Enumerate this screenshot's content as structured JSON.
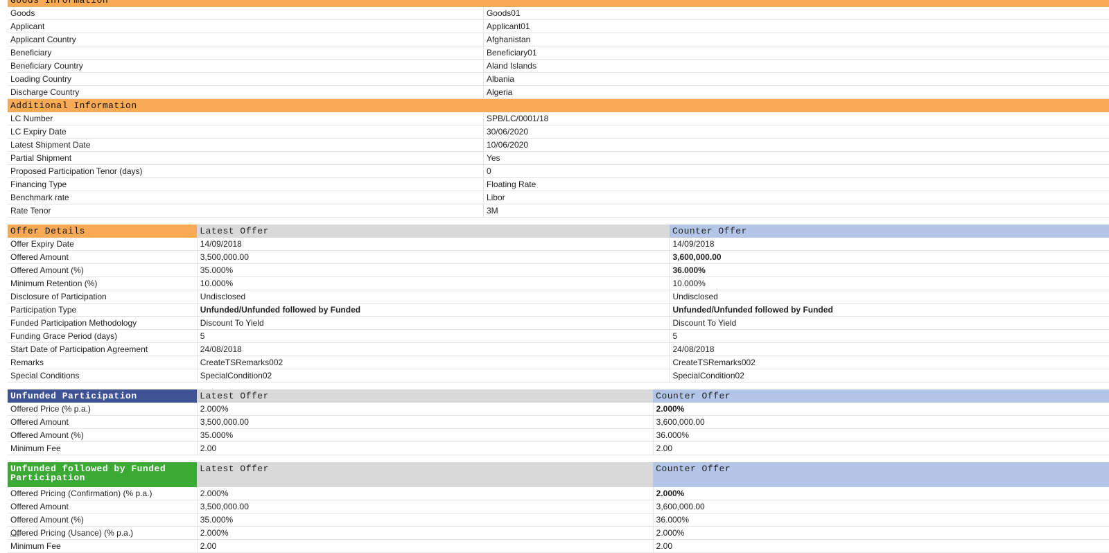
{
  "goods_section": {
    "title": "Goods Information",
    "rows": [
      {
        "label": "Goods",
        "value": "Goods01"
      },
      {
        "label": "Applicant",
        "value": "Applicant01"
      },
      {
        "label": "Applicant Country",
        "value": "Afghanistan"
      },
      {
        "label": "Beneficiary",
        "value": "Beneficiary01"
      },
      {
        "label": "Beneficiary Country",
        "value": "Aland Islands"
      },
      {
        "label": "Loading Country",
        "value": "Albania"
      },
      {
        "label": "Discharge Country",
        "value": "Algeria"
      }
    ]
  },
  "additional_section": {
    "title": "Additional Information",
    "rows": [
      {
        "label": "LC Number",
        "value": "SPB/LC/0001/18"
      },
      {
        "label": "LC Expiry Date",
        "value": "30/06/2020"
      },
      {
        "label": "Latest Shipment Date",
        "value": "10/06/2020"
      },
      {
        "label": "Partial Shipment",
        "value": "Yes"
      },
      {
        "label": "Proposed Participation Tenor (days)",
        "value": "0"
      },
      {
        "label": "Financing Type",
        "value": "Floating Rate"
      },
      {
        "label": "Benchmark rate",
        "value": "Libor"
      },
      {
        "label": "Rate Tenor",
        "value": "3M"
      }
    ]
  },
  "offer_details": {
    "title": "Offer Details",
    "latest_header": "Latest Offer",
    "counter_header": "Counter Offer",
    "rows": [
      {
        "label": "Offer Expiry Date",
        "latest": "14/09/2018",
        "counter": "14/09/2018"
      },
      {
        "label": "Offered Amount",
        "latest": "3,500,000.00",
        "counter": "3,600,000.00"
      },
      {
        "label": "Offered Amount (%)",
        "latest": "35.000%",
        "counter": "36.000%"
      },
      {
        "label": "Minimum Retention (%)",
        "latest": "10.000%",
        "counter": "10.000%"
      },
      {
        "label": "Disclosure of Participation",
        "latest": "Undisclosed",
        "counter": "Undisclosed"
      },
      {
        "label": "Participation Type",
        "latest": "Unfunded/Unfunded followed by Funded",
        "counter": "Unfunded/Unfunded followed by Funded"
      },
      {
        "label": "Funded Participation Methodology",
        "latest": "Discount To Yield",
        "counter": "Discount To Yield"
      },
      {
        "label": "Funding Grace Period (days)",
        "latest": "5",
        "counter": "5"
      },
      {
        "label": "Start Date of Participation Agreement",
        "latest": "24/08/2018",
        "counter": "24/08/2018"
      },
      {
        "label": "Remarks",
        "latest": "CreateTSRemarks002",
        "counter": "CreateTSRemarks002"
      },
      {
        "label": "Special Conditions",
        "latest": "SpecialCondition02",
        "counter": "SpecialCondition02"
      }
    ]
  },
  "unfunded": {
    "title": "Unfunded Participation",
    "latest_header": "Latest Offer",
    "counter_header": "Counter Offer",
    "rows": [
      {
        "label": "Offered Price (% p.a.)",
        "latest": "2.000%",
        "counter": "2.000%"
      },
      {
        "label": "Offered Amount",
        "latest": "3,500,000.00",
        "counter": "3,600,000.00"
      },
      {
        "label": "Offered Amount (%)",
        "latest": "35.000%",
        "counter": "36.000%"
      },
      {
        "label": "Minimum Fee",
        "latest": "2.00",
        "counter": "2.00"
      }
    ]
  },
  "unfunded_funded": {
    "title": "Unfunded followed by Funded Participation",
    "latest_header": "Latest Offer",
    "counter_header": "Counter Offer",
    "rows": [
      {
        "label": "Offered Pricing (Confirmation) (% p.a.)",
        "latest": "2.000%",
        "counter": "2.000%"
      },
      {
        "label": "Offered Amount",
        "latest": "3,500,000.00",
        "counter": "3,600,000.00"
      },
      {
        "label": "Offered Amount (%)",
        "latest": "35.000%",
        "counter": "36.000%"
      },
      {
        "label": "Offered Pricing (Usance) (% p.a.)",
        "latest": "2.000%",
        "counter": "2.000%"
      },
      {
        "label": "Minimum Fee",
        "latest": "2.00",
        "counter": "2.00"
      }
    ]
  },
  "footnote": "ccm",
  "colors": {
    "section_orange": "#f9aa55",
    "latest_grey": "#d9d9d9",
    "counter_blue": "#b4c6e7",
    "unfunded_navy": "#3f5294",
    "funded_green": "#3aaa35"
  }
}
